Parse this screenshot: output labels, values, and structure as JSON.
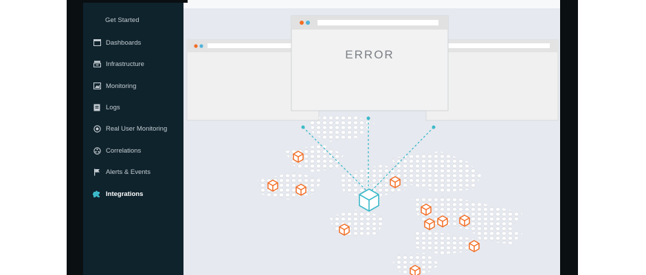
{
  "sidebar": {
    "get_started": "Get Started",
    "items": [
      {
        "label": "Dashboards",
        "icon": "dashboard-icon"
      },
      {
        "label": "Infrastructure",
        "icon": "server-icon"
      },
      {
        "label": "Monitoring",
        "icon": "monitor-icon"
      },
      {
        "label": "Logs",
        "icon": "logs-icon"
      },
      {
        "label": "Real User Monitoring",
        "icon": "rum-icon"
      },
      {
        "label": "Correlations",
        "icon": "correlations-icon"
      },
      {
        "label": "Alerts & Events",
        "icon": "flag-icon"
      },
      {
        "label": "Integrations",
        "icon": "puzzle-icon",
        "active": true
      }
    ]
  },
  "illustration": {
    "error_text": "ERROR"
  },
  "colors": {
    "sidebar_bg": "#0f232d",
    "main_bg": "#e6e9ef",
    "accent_cyan": "#3cb9c9",
    "node_orange": "#f26d24",
    "dot_red": "#f26d24",
    "dot_blue": "#4fb3d9"
  }
}
